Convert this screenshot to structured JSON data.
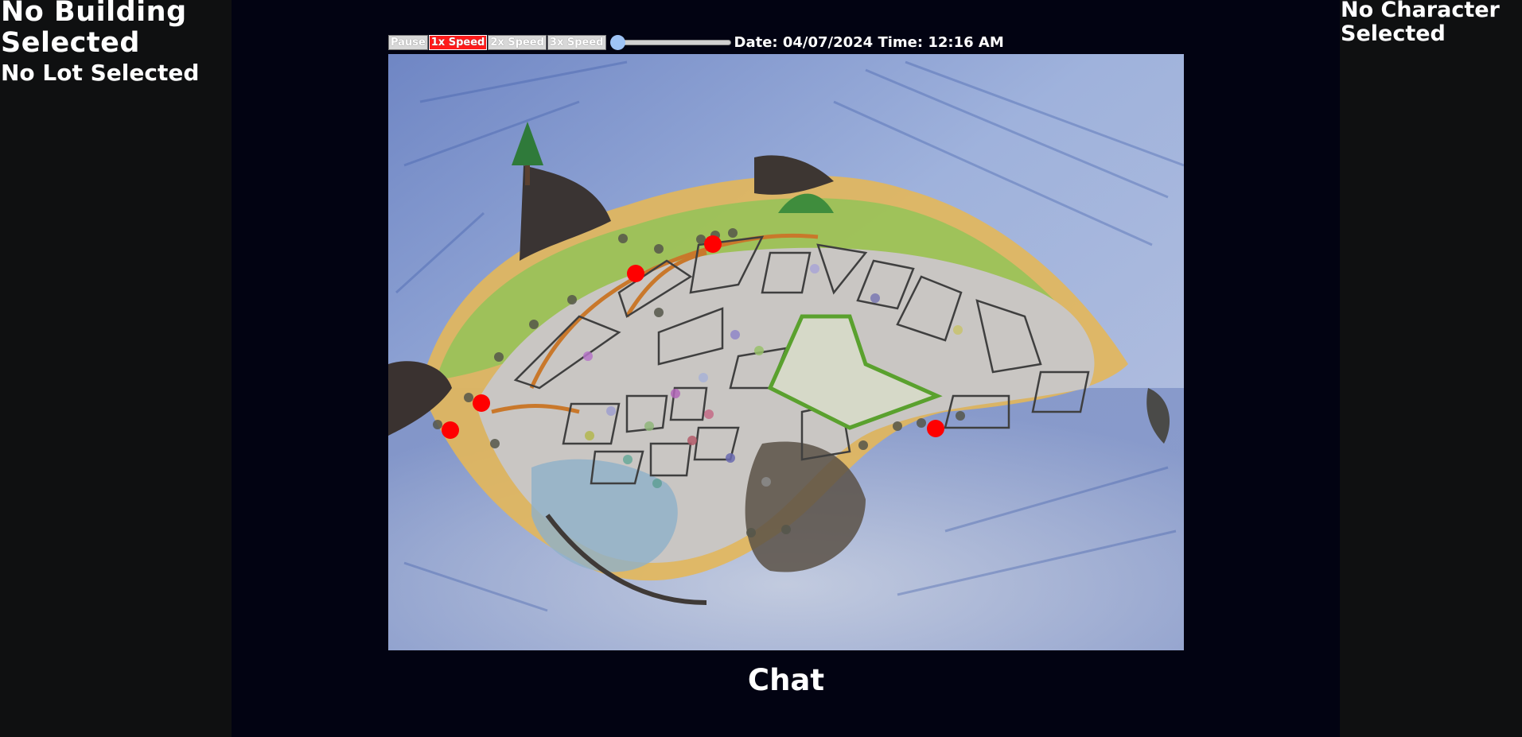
{
  "left_panel": {
    "building_title": "No Building Selected",
    "lot_title": "No Lot Selected"
  },
  "right_panel": {
    "character_title": "No Character Selected"
  },
  "controls": {
    "pause_label": "Pause",
    "speed_1x_label": "1x Speed",
    "speed_2x_label": "2x Speed",
    "speed_3x_label": "3x Speed",
    "active_speed": "1x Speed",
    "slider_value": 0,
    "date_time": "Date: 04/07/2024 Time: 12:16 AM"
  },
  "chat": {
    "title": "Chat"
  },
  "colors": {
    "background": "#020312",
    "panel": "#0f1011",
    "active_speed": "#ff1a1a",
    "slider_thumb": "#9ec3f5",
    "character_marker": "#ff0000",
    "lot_marker": "#55564a"
  }
}
